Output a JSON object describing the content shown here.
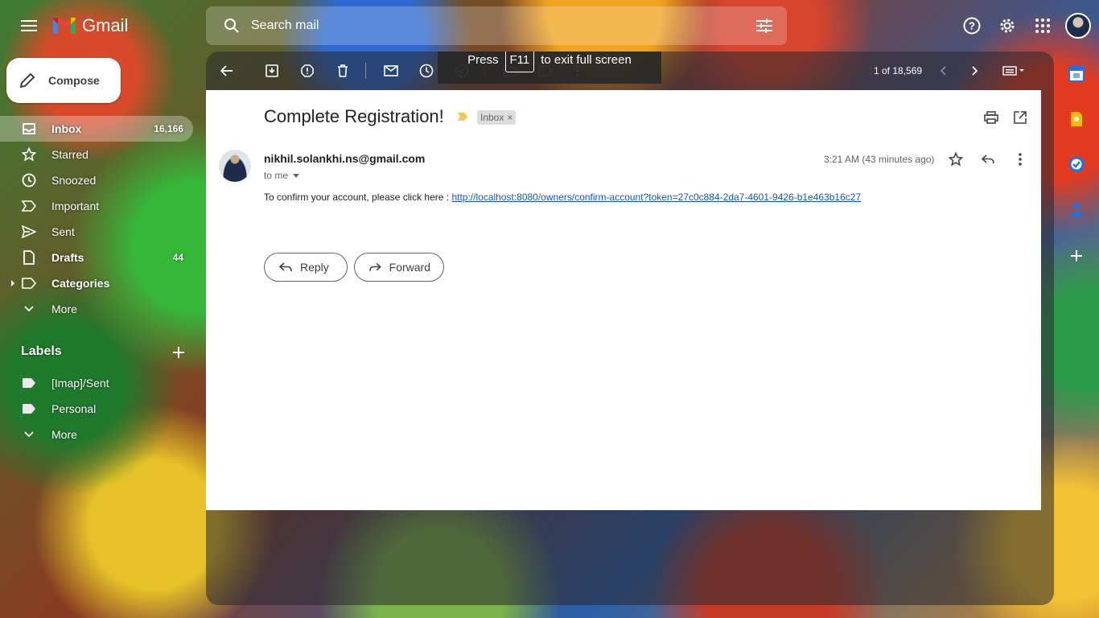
{
  "header": {
    "app_name": "Gmail",
    "search_placeholder": "Search mail"
  },
  "compose": {
    "label": "Compose"
  },
  "nav": {
    "items": [
      {
        "label": "Inbox",
        "count": "16,166",
        "icon": "inbox-icon"
      },
      {
        "label": "Starred",
        "count": "",
        "icon": "star-icon"
      },
      {
        "label": "Snoozed",
        "count": "",
        "icon": "clock-icon"
      },
      {
        "label": "Important",
        "count": "",
        "icon": "important-icon"
      },
      {
        "label": "Sent",
        "count": "",
        "icon": "send-icon"
      },
      {
        "label": "Drafts",
        "count": "44",
        "icon": "draft-icon"
      },
      {
        "label": "Categories",
        "count": "",
        "icon": "label-icon"
      },
      {
        "label": "More",
        "count": "",
        "icon": "chevron-down-icon"
      }
    ]
  },
  "labels": {
    "title": "Labels",
    "items": [
      {
        "label": "[Imap]/Sent",
        "icon": "label-icon"
      },
      {
        "label": "Personal",
        "icon": "label-icon"
      },
      {
        "label": "More",
        "icon": "chevron-down-icon"
      }
    ]
  },
  "toolbar": {
    "pager": "1 of 18,569"
  },
  "fullscreen_toast": {
    "prefix": "Press",
    "key": "F11",
    "suffix": "to exit full screen"
  },
  "email": {
    "subject": "Complete Registration!",
    "label_chip": "Inbox",
    "sender": "nikhil.solankhi.ns@gmail.com",
    "to": "to me",
    "time": "3:21 AM (43 minutes ago)",
    "body_prefix": "To confirm your account, please click here : ",
    "link": "http://localhost:8080/owners/confirm-account?token=27c0c884-2da7-4601-9426-b1e463b16c27"
  },
  "actions": {
    "reply": "Reply",
    "forward": "Forward"
  },
  "colors": {
    "link": "#1155cc",
    "importance_marker": "#f2c94c",
    "panel_bg": "#ffffff"
  }
}
